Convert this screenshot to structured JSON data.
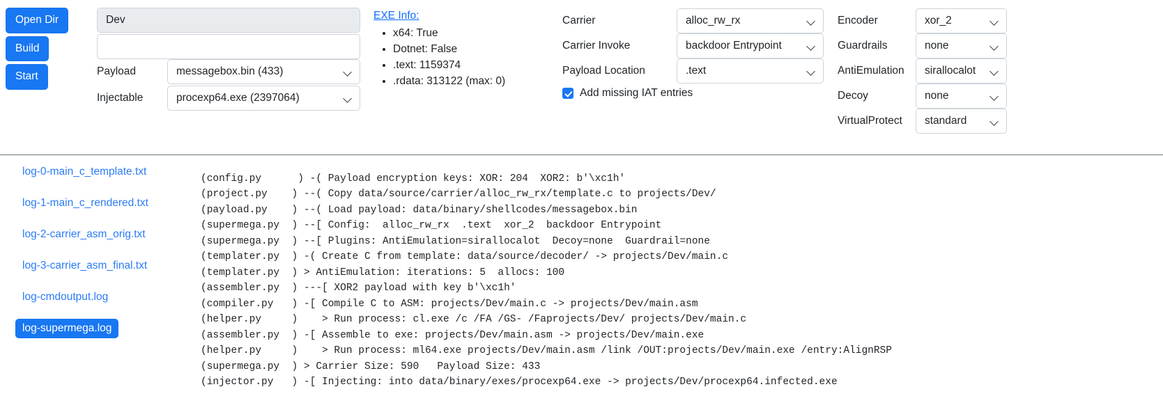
{
  "actions": {
    "buttons": [
      {
        "label": "Open Dir",
        "name": "open-dir-button"
      },
      {
        "label": "Build",
        "name": "build-button"
      },
      {
        "label": "Start",
        "name": "start-button"
      }
    ]
  },
  "project": {
    "name_value": "Dev",
    "name_placeholder": "",
    "comment_value": "",
    "comment_placeholder": ""
  },
  "payload_section": {
    "payload_label": "Payload",
    "payload_value": "messagebox.bin (433)",
    "injectable_label": "Injectable",
    "injectable_value": "procexp64.exe (2397064)"
  },
  "exe_info": {
    "title": "EXE Info:",
    "items": [
      "x64: True",
      "Dotnet: False",
      ".text: 1159374",
      ".rdata: 313122 (max: 0)"
    ]
  },
  "carrier_section": {
    "rows": [
      {
        "label": "Carrier",
        "value": "alloc_rw_rx",
        "name": "carrier"
      },
      {
        "label": "Carrier Invoke",
        "value": "backdoor Entrypoint",
        "name": "carrier-invoke"
      },
      {
        "label": "Payload Location",
        "value": ".text",
        "name": "payload-location"
      }
    ],
    "iat_label": "Add missing IAT entries",
    "iat_checked": true
  },
  "plugin_section": {
    "rows": [
      {
        "label": "Encoder",
        "value": "xor_2",
        "name": "encoder"
      },
      {
        "label": "Guardrails",
        "value": "none",
        "name": "guardrails"
      },
      {
        "label": "AntiEmulation",
        "value": "sirallocalot",
        "name": "antiemulation"
      },
      {
        "label": "Decoy",
        "value": "none",
        "name": "decoy"
      },
      {
        "label": "VirtualProtect",
        "value": "standard",
        "name": "virtualprotect"
      }
    ]
  },
  "log_files": [
    {
      "label": "log-0-main_c_template.txt",
      "active": false
    },
    {
      "label": "log-1-main_c_rendered.txt",
      "active": false
    },
    {
      "label": "log-2-carrier_asm_orig.txt",
      "active": false
    },
    {
      "label": "log-3-carrier_asm_final.txt",
      "active": false
    },
    {
      "label": "log-cmdoutput.log",
      "active": false
    },
    {
      "label": "log-supermega.log",
      "active": true
    }
  ],
  "log_output": {
    "text": "(config.py      ) -( Payload encryption keys: XOR: 204  XOR2: b'\\xc1h'\n(project.py    ) --( Copy data/source/carrier/alloc_rw_rx/template.c to projects/Dev/\n(payload.py    ) --( Load payload: data/binary/shellcodes/messagebox.bin\n(supermega.py  ) --[ Config:  alloc_rw_rx  .text  xor_2  backdoor Entrypoint\n(supermega.py  ) --[ Plugins: AntiEmulation=sirallocalot  Decoy=none  Guardrail=none\n(templater.py  ) -( Create C from template: data/source/decoder/ -> projects/Dev/main.c\n(templater.py  ) > AntiEmulation: iterations: 5  allocs: 100\n(assembler.py  ) ---[ XOR2 payload with key b'\\xc1h'\n(compiler.py   ) -[ Compile C to ASM: projects/Dev/main.c -> projects/Dev/main.asm\n(helper.py     )    > Run process: cl.exe /c /FA /GS- /Faprojects/Dev/ projects/Dev/main.c\n(assembler.py  ) -[ Assemble to exe: projects/Dev/main.asm -> projects/Dev/main.exe\n(helper.py     )    > Run process: ml64.exe projects/Dev/main.asm /link /OUT:projects/Dev/main.exe /entry:AlignRSP\n(supermega.py  ) > Carrier Size: 590   Payload Size: 433\n(injector.py   ) -[ Injecting: into data/binary/exes/procexp64.exe -> projects/Dev/procexp64.infected.exe"
  },
  "colors": {
    "accent_blue": "#1877f2",
    "link_blue": "#2b7cf5",
    "exe_info_link": "#0d6efd",
    "border_gray": "#ced4da",
    "divider_gray": "#6c757d",
    "readonly_bg": "#e9ecef",
    "text": "#212529"
  }
}
